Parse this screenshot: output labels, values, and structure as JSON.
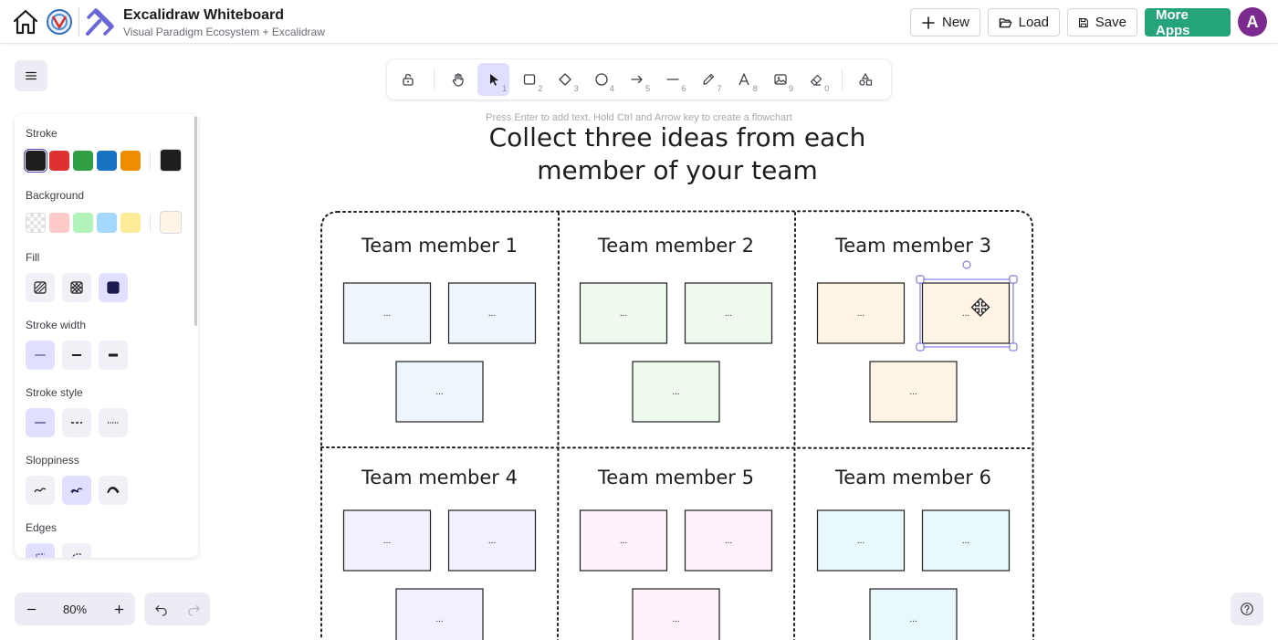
{
  "app": {
    "title": "Excalidraw Whiteboard",
    "subtitle": "Visual Paradigm Ecosystem + Excalidraw"
  },
  "topbar": {
    "new_label": "New",
    "load_label": "Load",
    "save_label": "Save",
    "more_apps_label": "More Apps",
    "avatar_initial": "A",
    "brand_color": "#25a37b",
    "avatar_color": "#7b2a8f"
  },
  "toolbar": {
    "active_tool": "selection",
    "tools": [
      {
        "name": "lock",
        "key": ""
      },
      {
        "name": "hand",
        "key": ""
      },
      {
        "name": "selection",
        "key": "1"
      },
      {
        "name": "rectangle",
        "key": "2"
      },
      {
        "name": "diamond",
        "key": "3"
      },
      {
        "name": "ellipse",
        "key": "4"
      },
      {
        "name": "arrow",
        "key": "5"
      },
      {
        "name": "line",
        "key": "6"
      },
      {
        "name": "draw",
        "key": "7"
      },
      {
        "name": "text",
        "key": "8"
      },
      {
        "name": "image",
        "key": "9"
      },
      {
        "name": "eraser",
        "key": "0"
      },
      {
        "name": "more-shapes",
        "key": ""
      }
    ]
  },
  "hint": "Press Enter to add text. Hold Ctrl and Arrow key to create a flowchart",
  "properties": {
    "stroke_label": "Stroke",
    "stroke_colors": [
      "#1e1e1e",
      "#e03131",
      "#2f9e44",
      "#1971c2",
      "#f08c00"
    ],
    "stroke_current": "#1e1e1e",
    "background_label": "Background",
    "background_colors": [
      "transparent",
      "#ffc9c9",
      "#b2f2bb",
      "#a5d8ff",
      "#ffec99"
    ],
    "background_current": "#fff4e6",
    "fill_label": "Fill",
    "fill_options": [
      "hachure",
      "cross-hatch",
      "solid"
    ],
    "fill_selected": "solid",
    "stroke_width_label": "Stroke width",
    "stroke_width_options": [
      "thin",
      "bold",
      "extra-bold"
    ],
    "stroke_width_selected": "thin",
    "stroke_style_label": "Stroke style",
    "stroke_style_options": [
      "solid",
      "dashed",
      "dotted"
    ],
    "stroke_style_selected": "solid",
    "sloppiness_label": "Sloppiness",
    "sloppiness_options": [
      "architect",
      "artist",
      "cartoonist"
    ],
    "sloppiness_selected": "artist",
    "edges_label": "Edges",
    "edges_options": [
      "sharp",
      "round"
    ],
    "edges_selected": "sharp"
  },
  "zoom": {
    "value": "80%"
  },
  "board": {
    "title_line1": "Collect three ideas from each",
    "title_line2": "member of your team",
    "members": [
      {
        "label": "Team member 1",
        "note_color": "#eef5fd"
      },
      {
        "label": "Team member 2",
        "note_color": "#eefaee"
      },
      {
        "label": "Team member 3",
        "note_color": "#fff4e6"
      },
      {
        "label": "Team member 4",
        "note_color": "#f1f0fd"
      },
      {
        "label": "Team member 5",
        "note_color": "#fff2fa"
      },
      {
        "label": "Team member 6",
        "note_color": "#e9f8fa"
      }
    ],
    "note_text": "...",
    "selected_note": "member-3-note-2",
    "selection_color": "#6965db"
  }
}
